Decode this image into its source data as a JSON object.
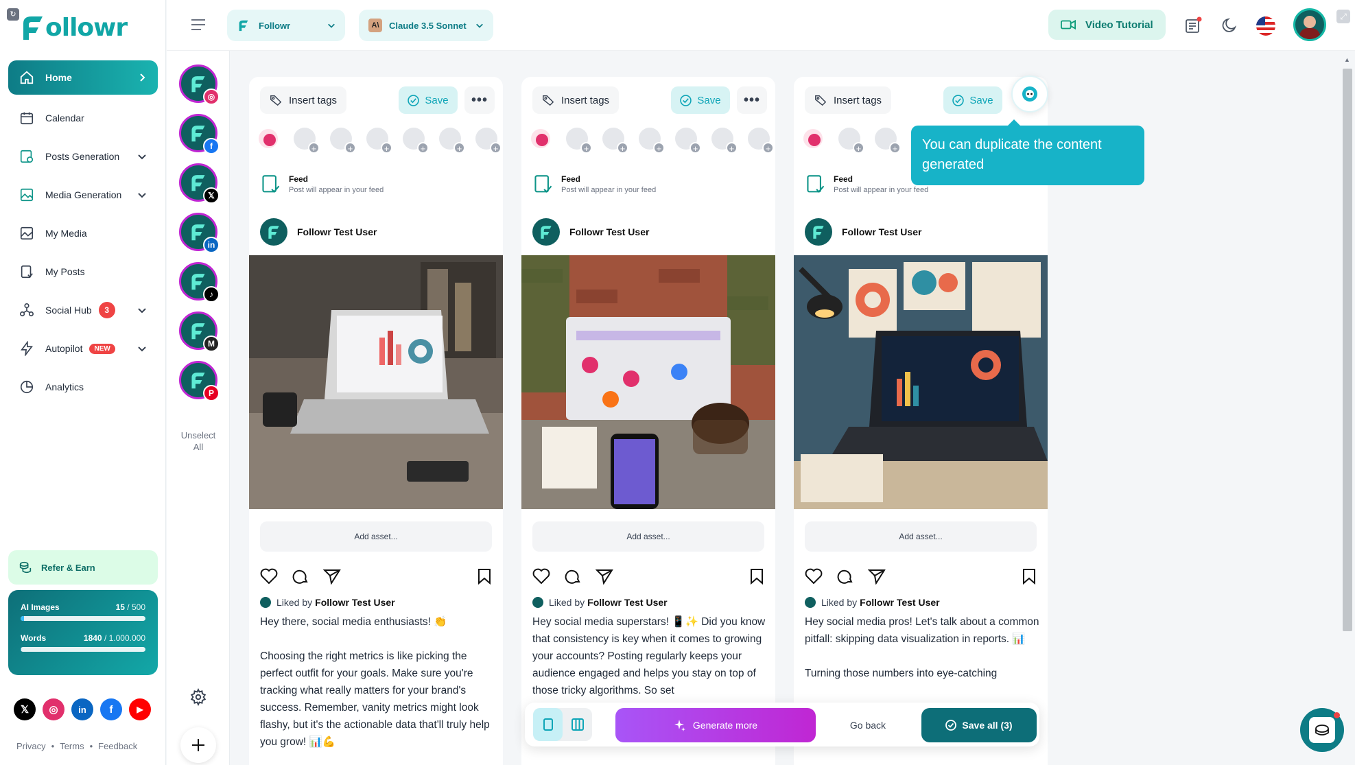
{
  "app": {
    "brand": "ollowr"
  },
  "sidebar": {
    "items": [
      {
        "label": "Home",
        "icon": "home-icon"
      },
      {
        "label": "Calendar",
        "icon": "calendar-icon"
      },
      {
        "label": "Posts Generation",
        "icon": "posts-generation-icon"
      },
      {
        "label": "Media Generation",
        "icon": "media-generation-icon"
      },
      {
        "label": "My Media",
        "icon": "image-icon"
      },
      {
        "label": "My Posts",
        "icon": "my-posts-icon"
      },
      {
        "label": "Social Hub",
        "icon": "social-hub-icon",
        "badge": "3"
      },
      {
        "label": "Autopilot",
        "icon": "lightning-icon",
        "badge": "NEW"
      },
      {
        "label": "Analytics",
        "icon": "analytics-icon"
      }
    ],
    "refer": "Refer & Earn",
    "usage": {
      "images_label": "AI Images",
      "images_used": "15",
      "images_total": "/ 500",
      "images_fraction": 0.03,
      "words_label": "Words",
      "words_used": "1840",
      "words_total": "/ 1.000.000",
      "words_fraction": 0.002
    },
    "footer": {
      "privacy": "Privacy",
      "terms": "Terms",
      "feedback": "Feedback",
      "sep": "•"
    }
  },
  "topbar": {
    "brand_select": "Followr",
    "model_select": "Claude 3.5 Sonnet",
    "video_tutorial": "Video Tutorial"
  },
  "accounts": {
    "list": [
      {
        "network": "instagram",
        "color": "#e1306c"
      },
      {
        "network": "facebook",
        "color": "#1877f2"
      },
      {
        "network": "x",
        "color": "#000000"
      },
      {
        "network": "linkedin",
        "color": "#0a66c2"
      },
      {
        "network": "tiktok",
        "color": "#000000"
      },
      {
        "network": "medium",
        "color": "#222222"
      },
      {
        "network": "pinterest",
        "color": "#e60023"
      }
    ],
    "unselect_1": "Unselect",
    "unselect_2": "All"
  },
  "card_common": {
    "insert_tags": "Insert tags",
    "save": "Save",
    "more": "•••",
    "feed_title": "Feed",
    "feed_sub": "Post will appear in your feed",
    "user": "Followr Test User",
    "add_asset": "Add asset...",
    "liked_prefix": "Liked by",
    "liked_user": "Followr Test User"
  },
  "cards": [
    {
      "caption": "Hey there, social media enthusiasts! 👏\n\nChoosing the right metrics is like picking the perfect outfit for your goals. Make sure you're tracking what really matters for your brand's success. Remember, vanity metrics might look flashy, but it's the actionable data that'll truly help you grow! 📊💪"
    },
    {
      "caption": "Hey social media superstars! 📱✨ Did you know that consistency is key when it comes to growing your accounts? Posting regularly keeps your audience engaged and helps you stay on top of those tricky algorithms. So set"
    },
    {
      "caption": "Hey social media pros! Let's talk about a common pitfall: skipping data visualization in reports. 📊\n\nTurning those numbers into eye-catching"
    }
  ],
  "tooltip": "You can duplicate the content generated",
  "bottombar": {
    "generate_more": "Generate more",
    "go_back": "Go back",
    "save_all": "Save all (3)"
  },
  "colors": {
    "accent": "#0d7c86",
    "brand": "#11a6a6",
    "purple": "#a855f7"
  }
}
